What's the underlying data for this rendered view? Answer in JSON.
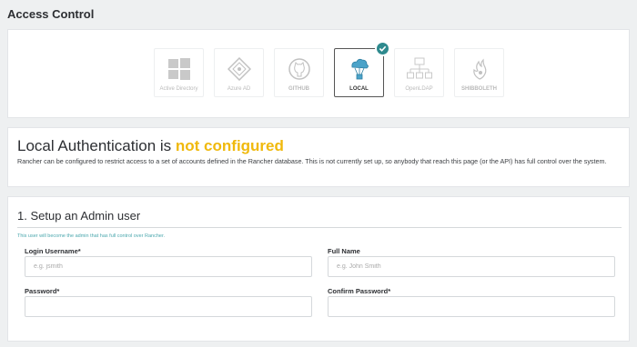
{
  "page": {
    "title": "Access Control"
  },
  "providers": [
    {
      "id": "ad",
      "label": "Active Directory",
      "icon": "windows-icon",
      "state": "disabled"
    },
    {
      "id": "azure",
      "label": "Azure AD",
      "icon": "azure-icon",
      "state": "disabled"
    },
    {
      "id": "github",
      "label": "GITHUB",
      "icon": "github-icon",
      "state": "disabled"
    },
    {
      "id": "local",
      "label": "LOCAL",
      "icon": "rancher-local-icon",
      "state": "active"
    },
    {
      "id": "openldap",
      "label": "OpenLDAP",
      "icon": "ldap-icon",
      "state": "disabled"
    },
    {
      "id": "shibboleth",
      "label": "SHIBBOLETH",
      "icon": "shibboleth-icon",
      "state": "disabled"
    }
  ],
  "status": {
    "heading_prefix": "Local Authentication is ",
    "heading_state": "not configured",
    "description": "Rancher can be configured to restrict access to a set of accounts defined in the Rancher database. This is not currently set up, so anybody that reach this page (or the API) has full control over the system."
  },
  "setup": {
    "heading": "1. Setup an Admin user",
    "hint": "This user will become the admin that has full control over Rancher.",
    "login_username": {
      "label": "Login Username*",
      "placeholder": "e.g. jsmith",
      "value": ""
    },
    "full_name": {
      "label": "Full Name",
      "placeholder": "e.g. John Smith",
      "value": ""
    },
    "password": {
      "label": "Password*",
      "placeholder": "",
      "value": ""
    },
    "confirm_password": {
      "label": "Confirm Password*",
      "placeholder": "",
      "value": ""
    }
  },
  "colors": {
    "accent": "#2e8a8e",
    "warning": "#f0b90c",
    "hint": "#4aa7ad",
    "background": "#eef0f1"
  }
}
